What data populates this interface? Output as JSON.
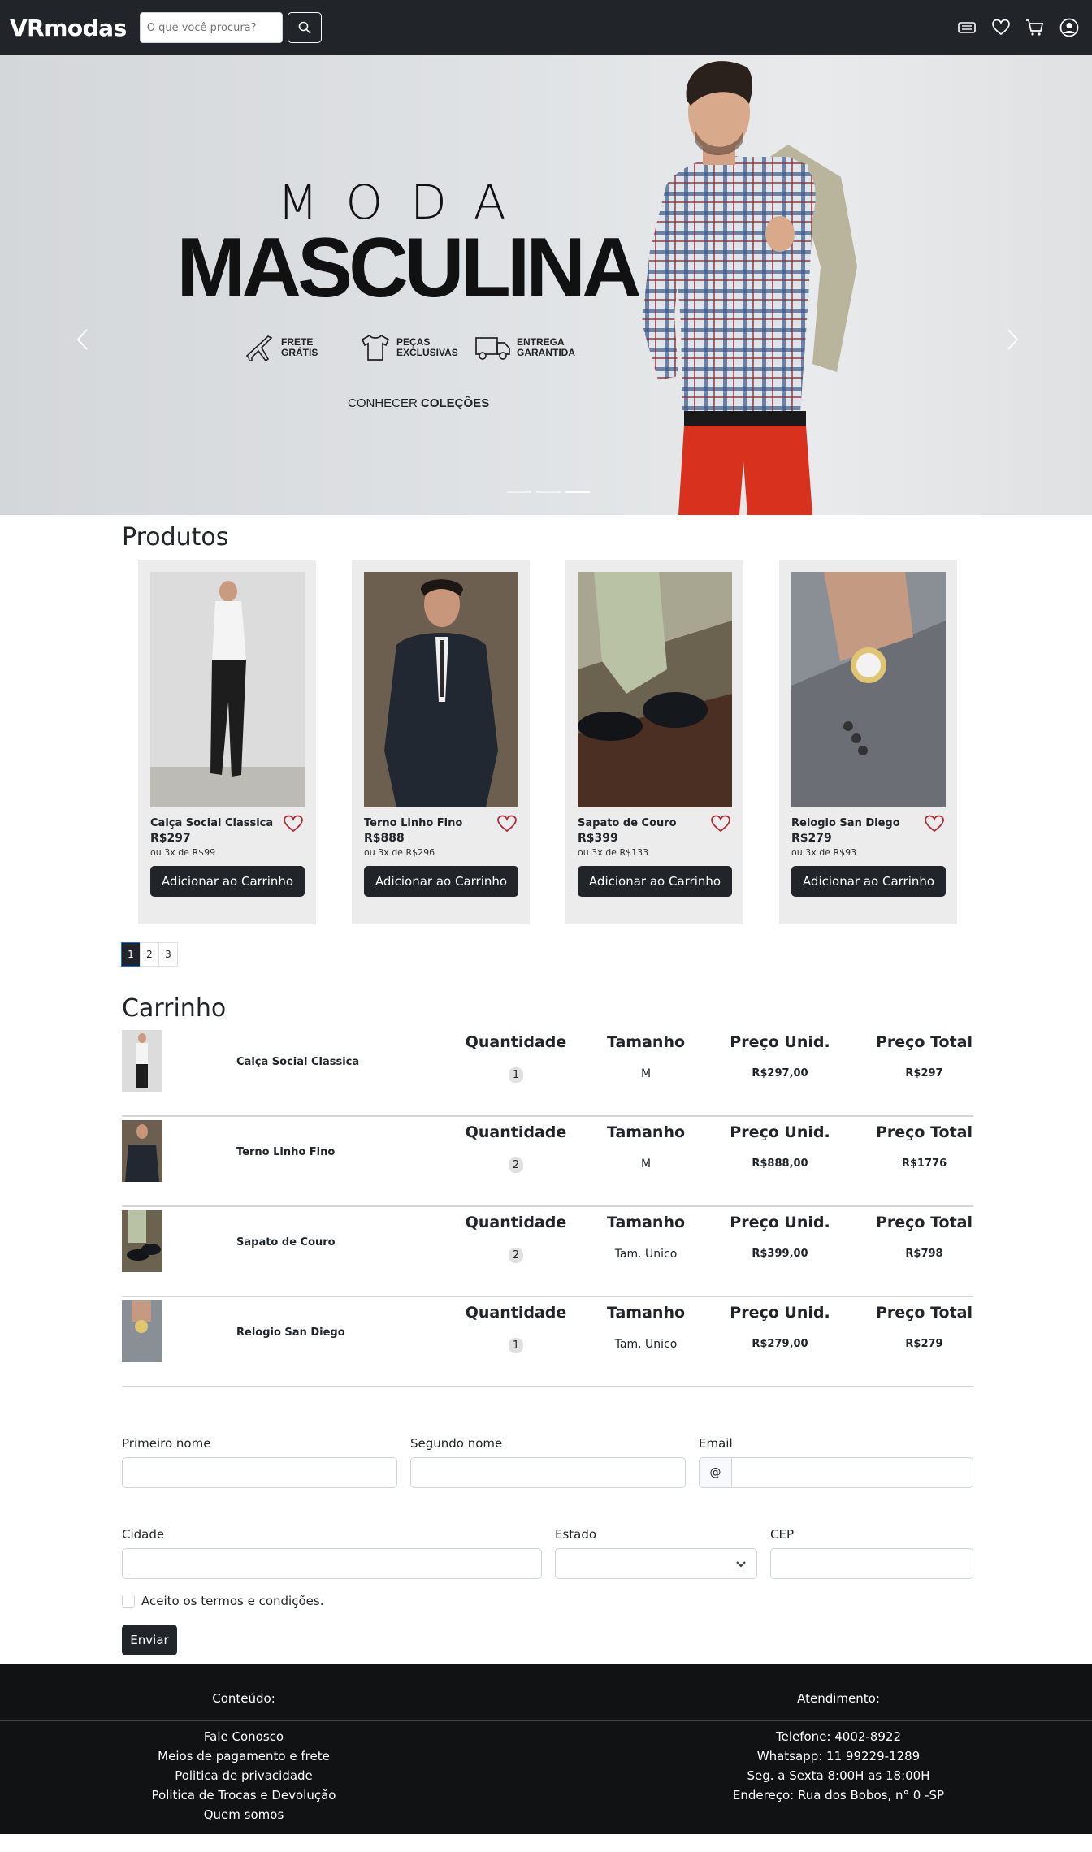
{
  "brand": "VRmodas",
  "search": {
    "placeholder": "O que você procura?"
  },
  "hero": {
    "line1": "MODA",
    "line2": "MASCULINA",
    "features": [
      {
        "icon": "plane-icon",
        "label": "FRETE GRÁTIS"
      },
      {
        "icon": "tshirt-icon",
        "label": "PEÇAS EXCLUSIVAS"
      },
      {
        "icon": "truck-icon",
        "label": "ENTREGA GARANTIDA"
      }
    ],
    "cta_pre": "CONHECER ",
    "cta_bold": "COLEÇÕES"
  },
  "products": {
    "title": "Produtos",
    "button_label": "Adicionar ao Carrinho",
    "items": [
      {
        "name": "Calça Social Classica",
        "price": "R$297",
        "installments": "ou 3x de R$99"
      },
      {
        "name": "Terno Linho Fino",
        "price": "R$888",
        "installments": "ou 3x de R$296"
      },
      {
        "name": "Sapato de Couro",
        "price": "R$399",
        "installments": "ou 3x de R$133"
      },
      {
        "name": "Relogio San Diego",
        "price": "R$279",
        "installments": "ou 3x de R$93"
      }
    ],
    "pages": [
      "1",
      "2",
      "3"
    ]
  },
  "cart": {
    "title": "Carrinho",
    "headers": {
      "qty": "Quantidade",
      "size": "Tamanho",
      "unit": "Preço Unid.",
      "total": "Preço Total"
    },
    "rows": [
      {
        "name": "Calça Social Classica",
        "qty": "1",
        "size": "M",
        "unit": "R$297,00",
        "total": "R$297"
      },
      {
        "name": "Terno Linho Fino",
        "qty": "2",
        "size": "M",
        "unit": "R$888,00",
        "total": "R$1776"
      },
      {
        "name": "Sapato de Couro",
        "qty": "2",
        "size": "Tam. Unico",
        "unit": "R$399,00",
        "total": "R$798"
      },
      {
        "name": "Relogio San Diego",
        "qty": "1",
        "size": "Tam. Unico",
        "unit": "R$279,00",
        "total": "R$279"
      }
    ]
  },
  "form": {
    "first_name": "Primeiro nome",
    "last_name": "Segundo nome",
    "email": "Email",
    "email_prefix": "@",
    "city": "Cidade",
    "state": "Estado",
    "zip": "CEP",
    "terms": "Aceito os termos e condições.",
    "submit": "Enviar"
  },
  "footer": {
    "left_title": "Conteúdo:",
    "left_links": [
      "Fale Conosco",
      "Meios de pagamento e frete",
      "Politica de privacidade",
      "Politica de Trocas e Devolução",
      "Quem somos"
    ],
    "right_title": "Atendimento:",
    "right_lines": [
      "Telefone: 4002-8922",
      "Whatsapp: 11 99229-1289",
      "Seg. a Sexta 8:00H as 18:00H",
      "Endereço: Rua dos Bobos, n° 0 -SP"
    ]
  },
  "colors": {
    "dark": "#212529",
    "footer": "#111213",
    "heart": "#b02a37",
    "pants_red": "#d8321e"
  }
}
